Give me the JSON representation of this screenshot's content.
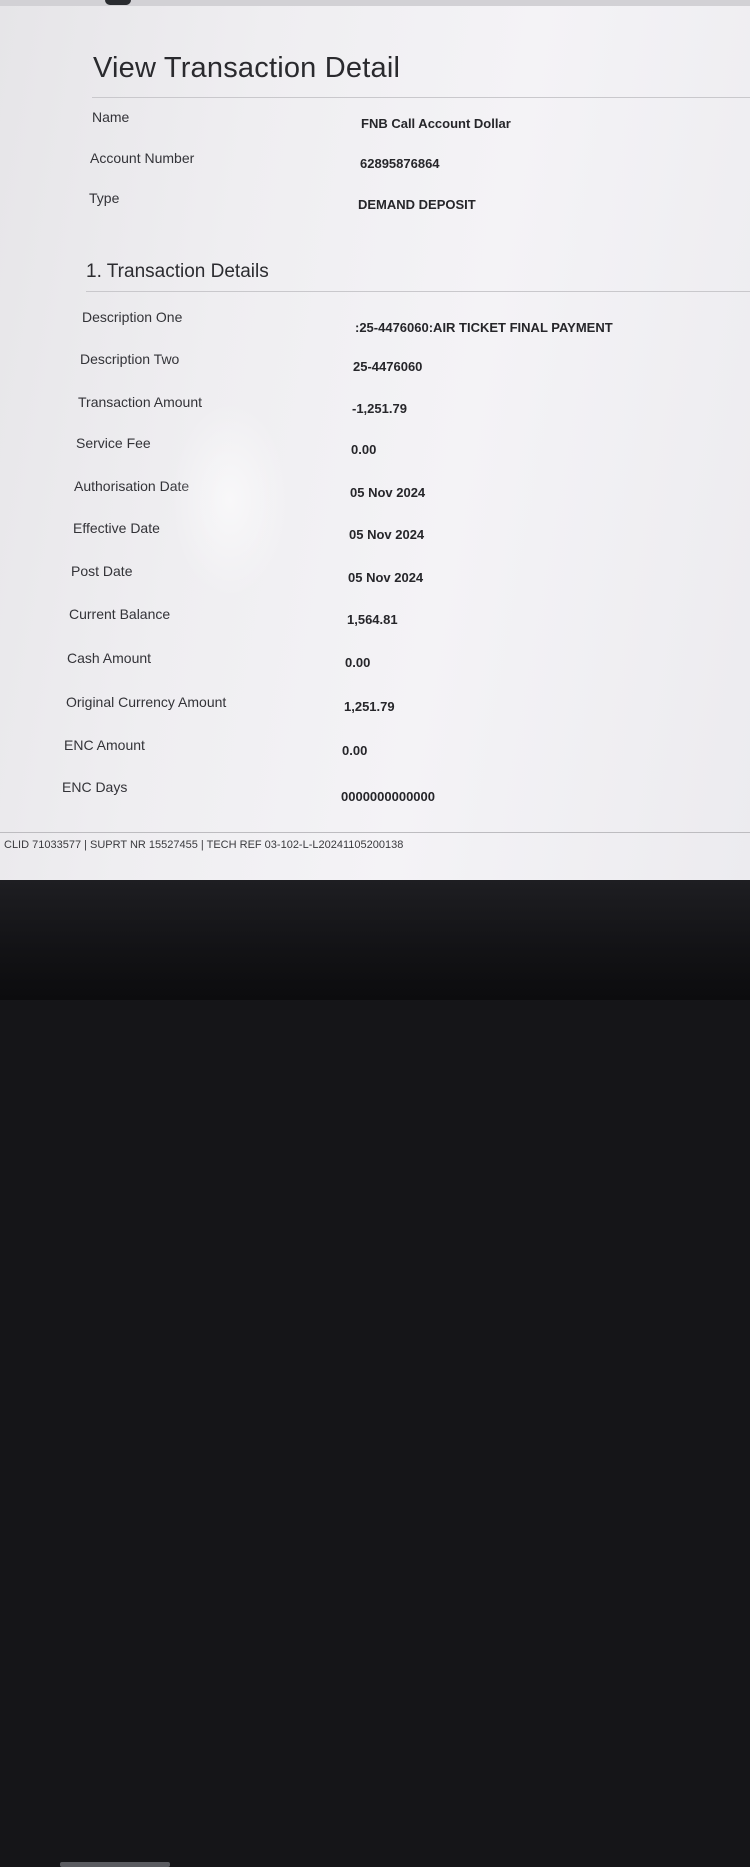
{
  "page_title": "View Transaction Detail",
  "account": {
    "name_label": "Name",
    "name_value": "FNB Call Account Dollar",
    "number_label": "Account Number",
    "number_value": "62895876864",
    "type_label": "Type",
    "type_value": "DEMAND DEPOSIT"
  },
  "transaction": {
    "section_title": "1. Transaction Details",
    "rows": [
      {
        "label": "Description One",
        "value": ":25-4476060:AIR TICKET FINAL PAYMENT"
      },
      {
        "label": "Description Two",
        "value": "25-4476060"
      },
      {
        "label": "Transaction Amount",
        "value": "-1,251.79"
      },
      {
        "label": "Service Fee",
        "value": "0.00"
      },
      {
        "label": "Authorisation Date",
        "value": "05 Nov 2024"
      },
      {
        "label": "Effective Date",
        "value": "05 Nov 2024"
      },
      {
        "label": "Post Date",
        "value": "05 Nov 2024"
      },
      {
        "label": "Current Balance",
        "value": "1,564.81"
      },
      {
        "label": "Cash Amount",
        "value": "0.00"
      },
      {
        "label": "Original Currency Amount",
        "value": "1,251.79"
      },
      {
        "label": "ENC Amount",
        "value": "0.00"
      },
      {
        "label": "ENC Days",
        "value": "0000000000000"
      }
    ]
  },
  "footer_text": "CLID 71033577 | SUPRT NR 15527455 | TECH REF 03-102-L-L20241105200138"
}
